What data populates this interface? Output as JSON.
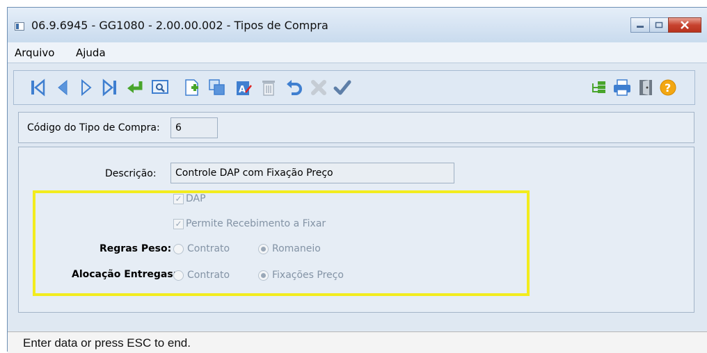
{
  "window": {
    "title": "06.9.6945 - GG1080 - 2.00.00.002 - Tipos de Compra",
    "controls": [
      "minimize-icon",
      "maximize-icon",
      "close-icon"
    ]
  },
  "menu": {
    "items": [
      "Arquivo",
      "Ajuda"
    ]
  },
  "toolbar": {
    "left_icons": [
      "first-record-icon",
      "previous-record-icon",
      "next-record-icon",
      "last-record-icon",
      "go-to-icon",
      "search-icon",
      "new-record-icon",
      "copy-icon",
      "edit-icon",
      "delete-icon",
      "undo-icon",
      "cancel-icon",
      "confirm-icon"
    ],
    "right_icons": [
      "tree-icon",
      "print-icon",
      "exit-icon",
      "help-icon"
    ]
  },
  "header": {
    "code_label": "Código do Tipo de Compra:",
    "code_value": "6"
  },
  "form": {
    "descricao_label": "Descrição:",
    "descricao_value": "Controle DAP com Fixação Preço",
    "dap_label": "DAP",
    "dap_checked": true,
    "permite_label": "Permite Recebimento a Fixar",
    "permite_checked": true,
    "regras_peso_label": "Regras Peso:",
    "regras_peso_options": [
      "Contrato",
      "Romaneio"
    ],
    "regras_peso_selected": "Romaneio",
    "alocacao_label": "Alocação Entregas:",
    "alocacao_options": [
      "Contrato",
      "Fixações Preço"
    ],
    "alocacao_selected": "Fixações Preço"
  },
  "colors": {
    "highlight_box": "#f2ec1e",
    "window_bg": "#dfe8f2"
  },
  "status": {
    "text": "Enter data or press ESC to end."
  }
}
